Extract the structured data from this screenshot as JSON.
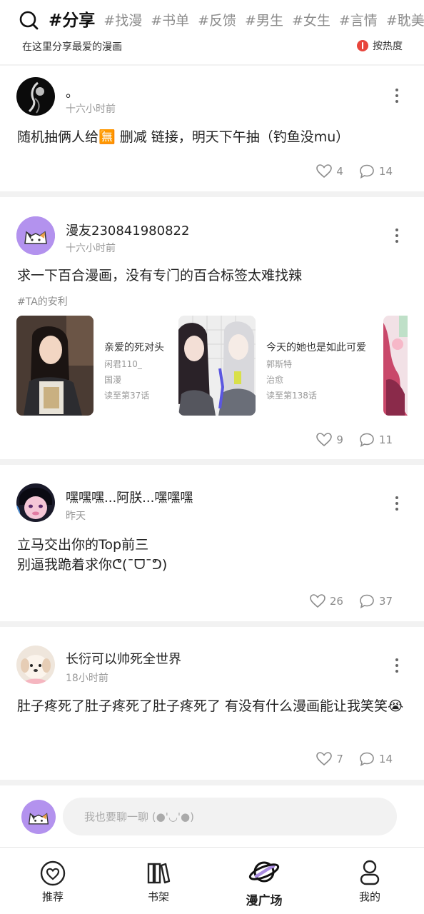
{
  "header": {
    "tabs": [
      {
        "label": "#分享",
        "active": true
      },
      {
        "label": "#找漫"
      },
      {
        "label": "#书单"
      },
      {
        "label": "#反馈"
      },
      {
        "label": "#男生"
      },
      {
        "label": "#女生"
      },
      {
        "label": "#言情"
      },
      {
        "label": "#耽美"
      }
    ],
    "subtitle": "在这里分享最爱的漫画",
    "sort_label": "按热度"
  },
  "posts": [
    {
      "username": "。",
      "time": "十六小时前",
      "text": "随机抽俩人给🈚 删减 链接，明天下午抽（钓鱼没mu）",
      "likes": "4",
      "comments": "14"
    },
    {
      "username": "漫友230841980822",
      "time": "十六小时前",
      "text": "求一下百合漫画，没有专门的百合标签太难找辣",
      "tag": "#TA的安利",
      "comics": [
        {
          "title": "亲爱的死对头",
          "author": "闲君110_",
          "category": "国漫",
          "progress": "读至第37话"
        },
        {
          "title": "今天的她也是如此可爱",
          "author": "郭斯特",
          "category": "治愈",
          "progress": "读至第138话"
        }
      ],
      "likes": "9",
      "comments": "11"
    },
    {
      "username": "嘿嘿嘿...阿朕...嘿嘿嘿",
      "time": "昨天",
      "text_lines": [
        "立马交出你的Top前三",
        "别逼我跪着求你ᕦ(¯ᗜ¯ᕤ)"
      ],
      "likes": "26",
      "comments": "37"
    },
    {
      "username": "长衍可以帅死全世界",
      "time": "18小时前",
      "text": "肚子疼死了肚子疼死了肚子疼死了 有没有什么漫画能让我笑笑😭",
      "likes": "7",
      "comments": "14"
    }
  ],
  "composer": {
    "placeholder": "我也要聊一聊 (●'◡'●)"
  },
  "bottom_nav": [
    {
      "label": "推荐",
      "icon": "heart-circle-icon"
    },
    {
      "label": "书架",
      "icon": "books-icon"
    },
    {
      "label": "漫广场",
      "icon": "planet-icon",
      "active": true
    },
    {
      "label": "我的",
      "icon": "person-icon"
    }
  ],
  "colors": {
    "accent": "#a98ce0",
    "hot": "#e8453c",
    "separator": "#f2f2f2",
    "muted": "#8c8c8c"
  }
}
